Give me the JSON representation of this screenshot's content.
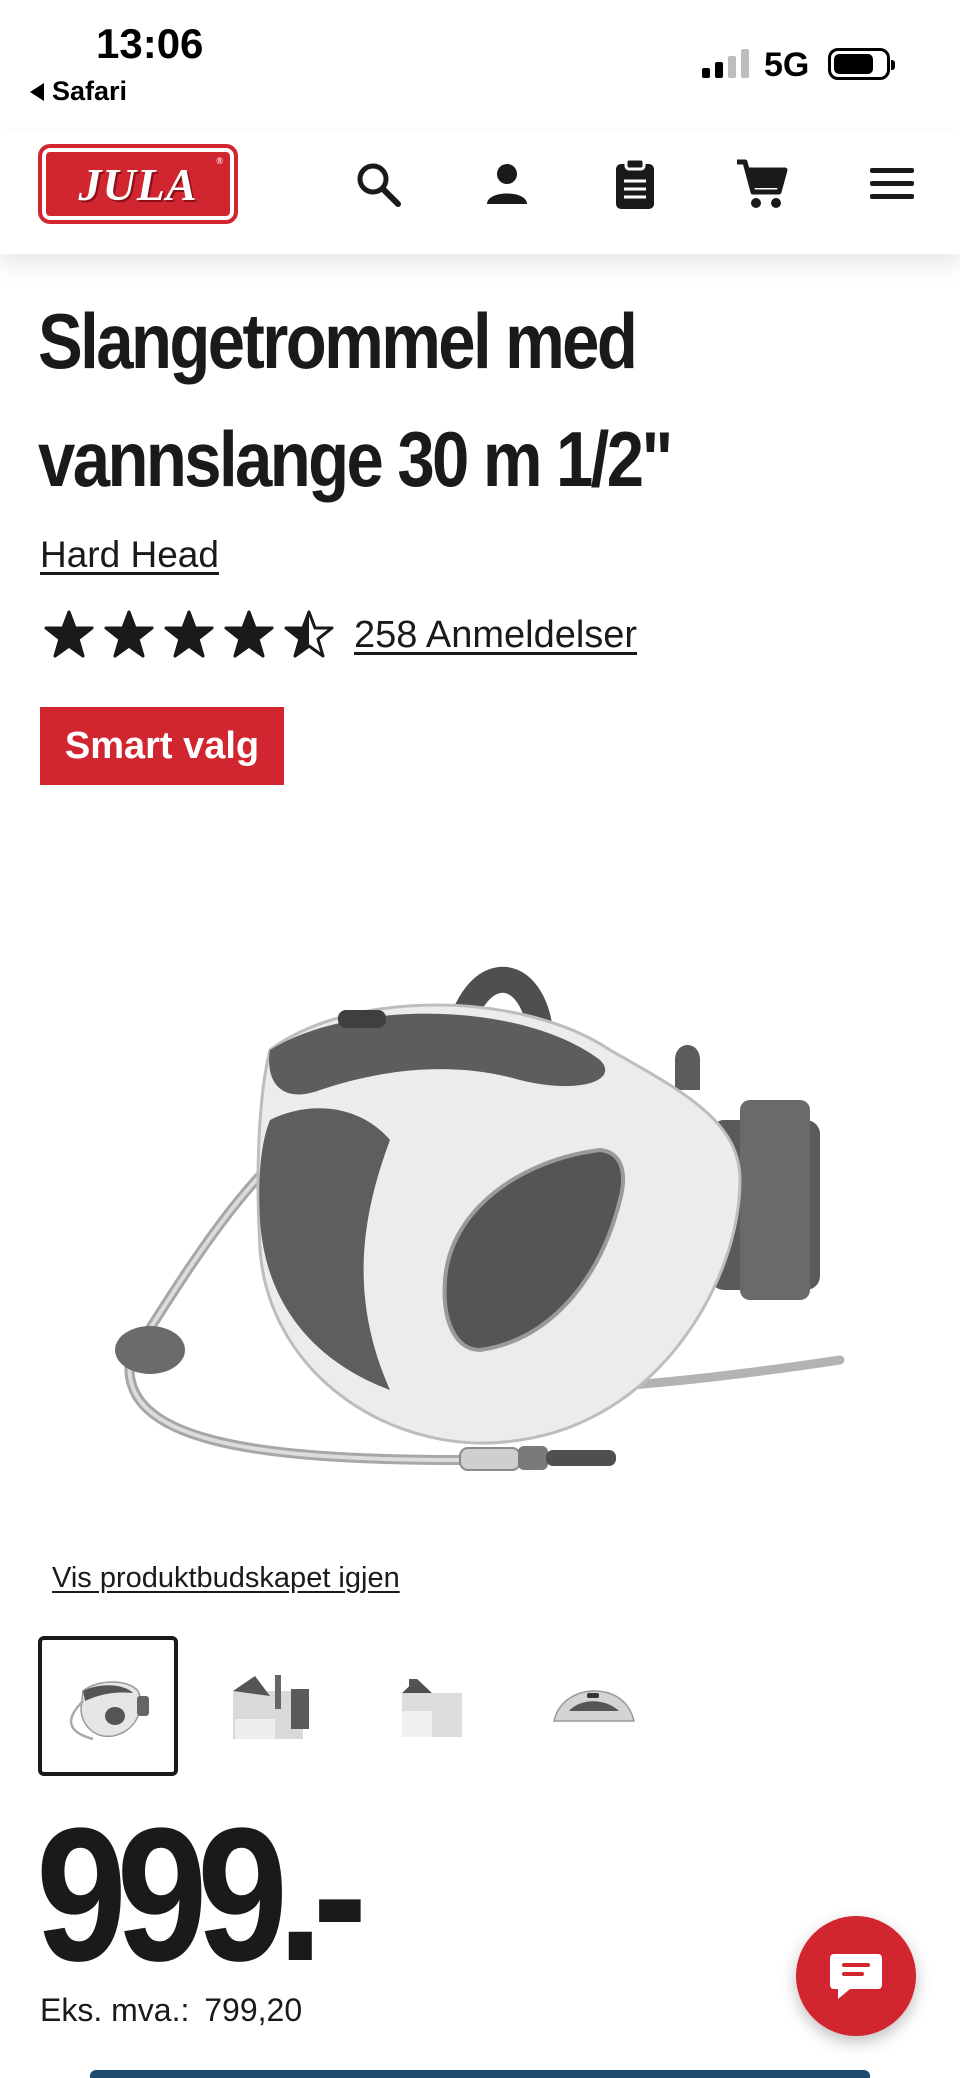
{
  "status_bar": {
    "time": "13:06",
    "back_app": "Safari",
    "network": "5G",
    "signal_bars": 2,
    "battery_level": 0.78
  },
  "header": {
    "logo_text": "JULA",
    "logo_registered": "®",
    "brand_color": "#d1262f",
    "icons": [
      "search-icon",
      "account-icon",
      "shopping-list-icon",
      "cart-icon",
      "menu-icon"
    ]
  },
  "product": {
    "title": "Slangetrommel med vannslange 30 m 1/2\"",
    "brand": "Hard Head",
    "rating": 4.5,
    "rating_max": 5,
    "reviews_label": "258 Anmeldelser",
    "badge": "Smart valg",
    "restore_link": "Vis produktbudskapet igjen",
    "thumbnail_count": 4,
    "active_thumbnail": 1,
    "price": "999.-",
    "vat_label": "Eks. mva.:",
    "vat_price": "799,20"
  },
  "chat": {
    "icon": "chat-bubble-icon"
  }
}
